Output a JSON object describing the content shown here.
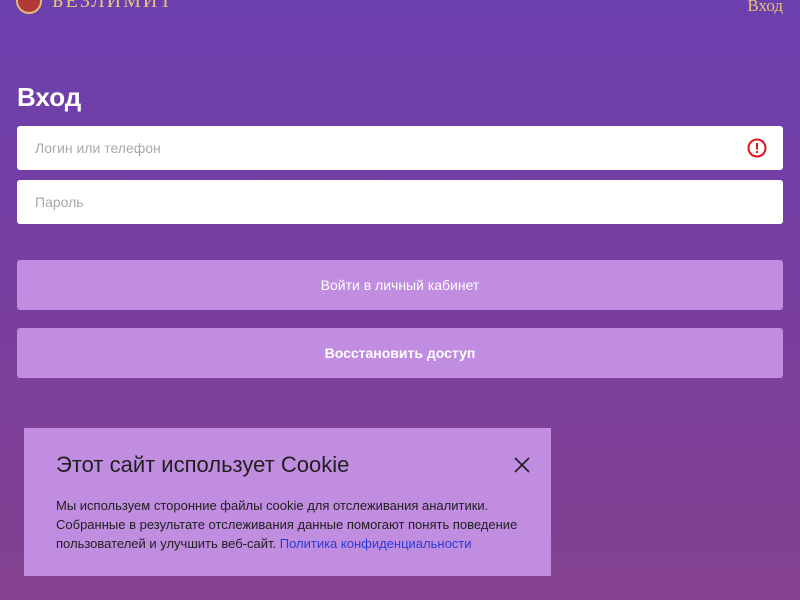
{
  "header": {
    "logo_text": "БЕЗЛИМИТ",
    "login_link": "Вход"
  },
  "page": {
    "title": "Вход"
  },
  "form": {
    "login_placeholder": "Логин или телефон",
    "password_placeholder": "Пароль",
    "login_button": "Войти в личный кабинет",
    "restore_button": "Восстановить доступ"
  },
  "cookie": {
    "title": "Этот сайт использует Cookie",
    "text": "Мы используем сторонние файлы cookie для отслеживания аналитики. Собранные в результате отслеживания данные помогают понять поведение пользователей и улучшить веб-сайт.",
    "link_text": "Политика конфиденциальности"
  },
  "colors": {
    "accent_gold": "#e8c27a",
    "button": "#c08de0",
    "error": "#e0121e",
    "link": "#2a3bd6"
  }
}
